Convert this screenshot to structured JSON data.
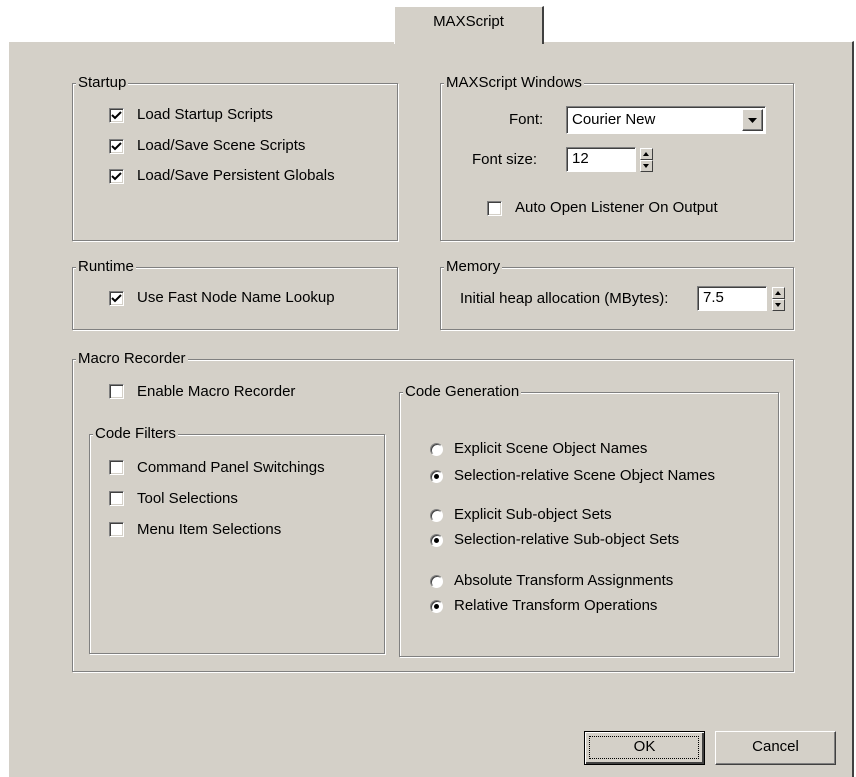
{
  "tab": {
    "label": "MAXScript"
  },
  "startup": {
    "title": "Startup",
    "items": [
      {
        "label": "Load Startup Scripts",
        "checked": true
      },
      {
        "label": "Load/Save Scene Scripts",
        "checked": true
      },
      {
        "label": "Load/Save Persistent Globals",
        "checked": true
      }
    ]
  },
  "windows": {
    "title": "MAXScript Windows",
    "font_label": "Font:",
    "font_value": "Courier New",
    "fontsize_label": "Font size:",
    "fontsize_value": "12",
    "auto_open": {
      "label": "Auto Open Listener On Output",
      "checked": false
    }
  },
  "runtime": {
    "title": "Runtime",
    "fast_lookup": {
      "label": "Use Fast Node Name Lookup",
      "checked": true
    }
  },
  "memory": {
    "title": "Memory",
    "heap_label": "Initial heap allocation (MBytes):",
    "heap_value": "7.5"
  },
  "macro": {
    "title": "Macro Recorder",
    "enable": {
      "label": "Enable Macro Recorder",
      "checked": false
    },
    "filters": {
      "title": "Code Filters",
      "items": [
        {
          "label": "Command Panel Switchings",
          "checked": false
        },
        {
          "label": "Tool Selections",
          "checked": false
        },
        {
          "label": "Menu Item Selections",
          "checked": false
        }
      ]
    },
    "codegen": {
      "title": "Code Generation",
      "radios": [
        {
          "label": "Explicit Scene Object Names",
          "selected": false
        },
        {
          "label": "Selection-relative Scene Object Names",
          "selected": true
        },
        {
          "label": "Explicit Sub-object Sets",
          "selected": false
        },
        {
          "label": "Selection-relative Sub-object Sets",
          "selected": true
        },
        {
          "label": "Absolute Transform Assignments",
          "selected": false
        },
        {
          "label": "Relative Transform Operations",
          "selected": true
        }
      ]
    }
  },
  "buttons": {
    "ok": "OK",
    "cancel": "Cancel"
  },
  "colors": {
    "face": "#d4d0c8",
    "shadow": "#808080",
    "highlight": "#ffffff"
  }
}
